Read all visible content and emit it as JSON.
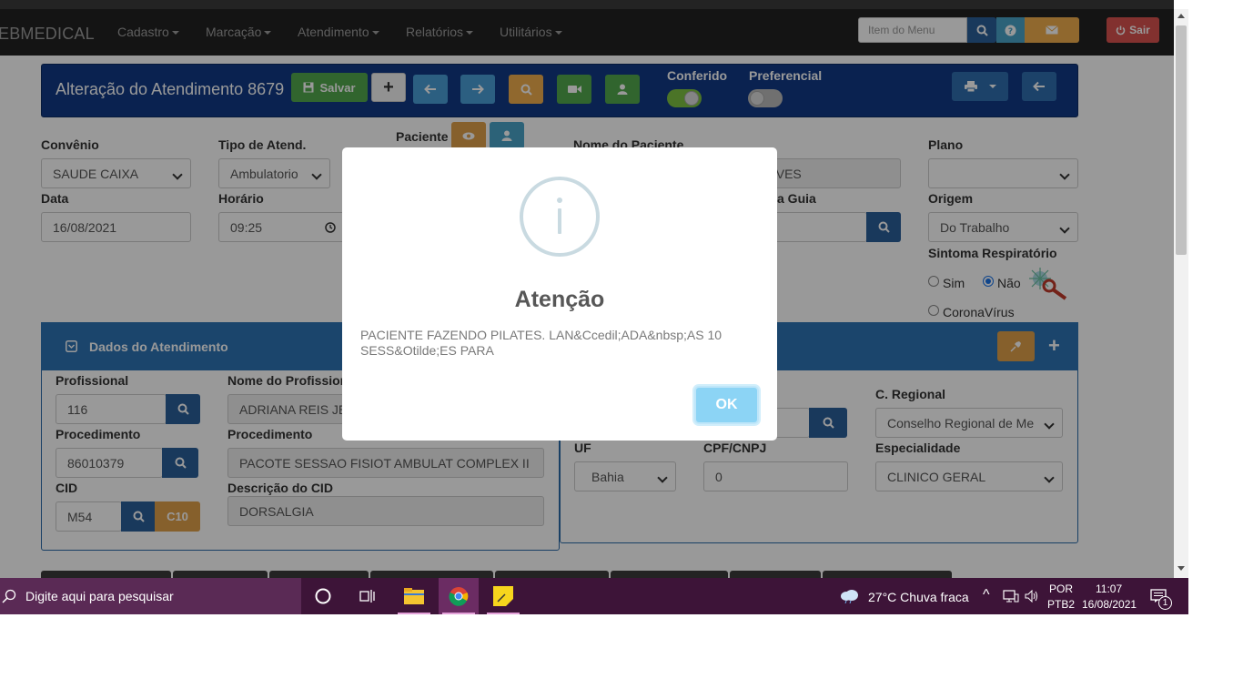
{
  "navbar": {
    "brand": "EBMEDICAL",
    "menus": [
      "Cadastro",
      "Marcação",
      "Atendimento",
      "Relatórios",
      "Utilitários"
    ],
    "search_placeholder": "Item do Menu",
    "logout_label": "Sair"
  },
  "header": {
    "title": "Alteração do Atendimento 8679",
    "save_label": "Salvar",
    "switch_conferido": "Conferido",
    "switch_preferencial": "Preferencial"
  },
  "form": {
    "convenio_label": "Convênio",
    "convenio_value": "SAUDE CAIXA",
    "tipo_label": "Tipo de Atend.",
    "tipo_value": "Ambulatorio",
    "paciente_label": "Paciente",
    "nome_label": "Nome do Paciente",
    "nome_value": "LVES",
    "plano_label": "Plano",
    "plano_value": "",
    "data_label": "Data",
    "data_value": "16/08/2021",
    "horario_label": "Horário",
    "horario_value": "09:25",
    "guia_label": "a Guia",
    "origem_label": "Origem",
    "origem_value": "Do Trabalho",
    "sintoma_label": "Sintoma Respiratório",
    "radio_sim": "Sim",
    "radio_nao": "Não",
    "radio_corona": "CoronaVírus"
  },
  "section": {
    "title": "Dados do Atendimento",
    "profissional_label": "Profissional",
    "profissional_value": "116",
    "nome_prof_label": "Nome do Profission",
    "nome_prof_value": "ADRIANA REIS JE",
    "procedimento_label": "Procedimento",
    "procedimento_code": "86010379",
    "procedimento_desc_label": "Procedimento",
    "procedimento_desc": "PACOTE SESSAO FISIOT AMBULAT COMPLEX II",
    "cid_label": "CID",
    "cid_value": "M54",
    "c10_label": "C10",
    "desc_cid_label": "Descrição do CID",
    "desc_cid_value": "DORSALGIA",
    "regional_label": "C. Regional",
    "regional_value": "Conselho Regional de Me",
    "uf_label": "UF",
    "uf_value": "Bahia",
    "cpf_label": "CPF/CNPJ",
    "cpf_value": "0",
    "especialidade_label": "Especialidade",
    "especialidade_value": "CLINICO GERAL"
  },
  "dialog": {
    "title": "Atenção",
    "message": "PACIENTE FAZENDO PILATES. LAN&Ccedil;ADA&nbsp;AS 10 SESS&Otilde;ES PARA",
    "ok_label": "OK"
  },
  "taskbar": {
    "search_placeholder": "Digite aqui para pesquisar",
    "weather": "27°C  Chuva fraca",
    "lang_top": "POR",
    "lang_bottom": "PTB2",
    "time": "11:07",
    "date": "16/08/2021",
    "notifications": "1"
  },
  "colors": {
    "header_bg": "#123a85",
    "section_bg": "#2e74b5",
    "ok_button": "#8cd4f5",
    "logout": "#d9534f"
  }
}
